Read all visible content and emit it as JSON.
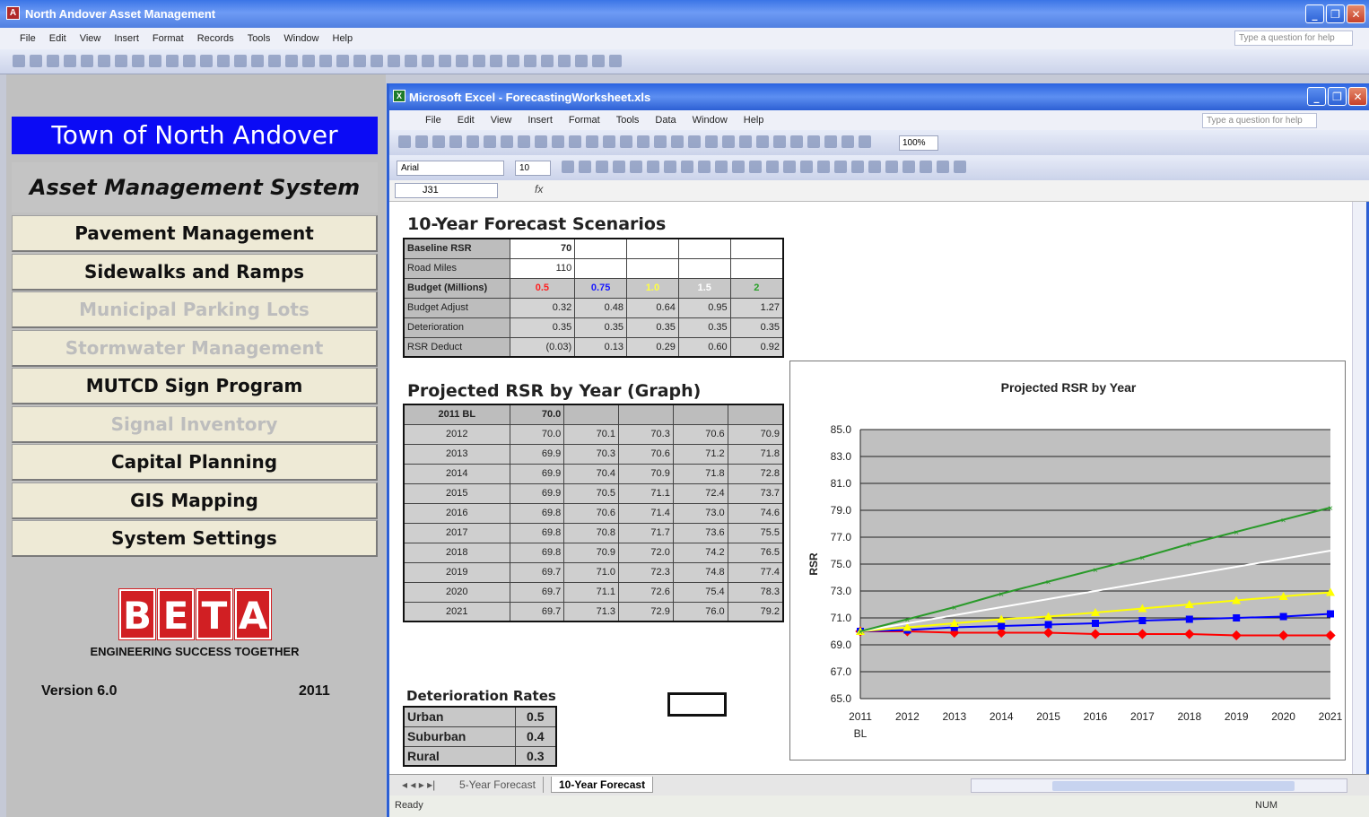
{
  "access_window": {
    "title": "North Andover Asset Management",
    "menu": [
      "File",
      "Edit",
      "View",
      "Insert",
      "Format",
      "Records",
      "Tools",
      "Window",
      "Help"
    ],
    "help_placeholder": "Type a question for help"
  },
  "switchboard": {
    "town": "Town of North Andover",
    "system": "Asset Management System",
    "buttons": [
      {
        "label": "Pavement Management",
        "enabled": true
      },
      {
        "label": "Sidewalks and  Ramps",
        "enabled": true
      },
      {
        "label": "Municipal Parking Lots",
        "enabled": false
      },
      {
        "label": "Stormwater Management",
        "enabled": false
      },
      {
        "label": "MUTCD Sign Program",
        "enabled": true
      },
      {
        "label": "Signal Inventory",
        "enabled": false
      },
      {
        "label": "Capital Planning",
        "enabled": true
      },
      {
        "label": "GIS Mapping",
        "enabled": true
      },
      {
        "label": "System Settings",
        "enabled": true
      }
    ],
    "logo_letters": [
      "B",
      "E",
      "T",
      "A"
    ],
    "tagline": "ENGINEERING  SUCCESS TOGETHER",
    "version": "Version 6.0",
    "year": "2011"
  },
  "excel_window": {
    "title": "Microsoft Excel - ForecastingWorksheet.xls",
    "menu": [
      "File",
      "Edit",
      "View",
      "Insert",
      "Format",
      "Tools",
      "Data",
      "Window",
      "Help"
    ],
    "help_placeholder": "Type a question for help",
    "font": "Arial",
    "font_size": "10",
    "zoom": "100%",
    "name_box": "J31",
    "fx": "fx",
    "status": "Ready",
    "num": "NUM",
    "tabs": [
      "5-Year Forecast",
      "10-Year Forecast"
    ],
    "active_tab": "10-Year Forecast"
  },
  "forecast": {
    "title": "10-Year Forecast Scenarios",
    "rows": [
      {
        "label": "Baseline RSR",
        "cells": [
          "70",
          "",
          "",
          "",
          ""
        ]
      },
      {
        "label": "Road Miles",
        "cells": [
          "110",
          "",
          "",
          "",
          ""
        ]
      },
      {
        "label": "Budget (Millions)",
        "cells": [
          "0.5",
          "0.75",
          "1.0",
          "1.5",
          "2"
        ]
      },
      {
        "label": "Budget Adjust",
        "cells": [
          "0.32",
          "0.48",
          "0.64",
          "0.95",
          "1.27"
        ]
      },
      {
        "label": "Deterioration",
        "cells": [
          "0.35",
          "0.35",
          "0.35",
          "0.35",
          "0.35"
        ]
      },
      {
        "label": "RSR Deduct",
        "cells": [
          "(0.03)",
          "0.13",
          "0.29",
          "0.60",
          "0.92"
        ]
      }
    ],
    "budget_colors": [
      "#ff2020",
      "#1a1aff",
      "#ffff40",
      "#ffffff",
      "#28a028"
    ]
  },
  "projected": {
    "title": "Projected RSR by Year (Graph)",
    "header": [
      "2011 BL",
      "70.0"
    ],
    "rows": [
      [
        "2012",
        "70.0",
        "70.1",
        "70.3",
        "70.6",
        "70.9"
      ],
      [
        "2013",
        "69.9",
        "70.3",
        "70.6",
        "71.2",
        "71.8"
      ],
      [
        "2014",
        "69.9",
        "70.4",
        "70.9",
        "71.8",
        "72.8"
      ],
      [
        "2015",
        "69.9",
        "70.5",
        "71.1",
        "72.4",
        "73.7"
      ],
      [
        "2016",
        "69.8",
        "70.6",
        "71.4",
        "73.0",
        "74.6"
      ],
      [
        "2017",
        "69.8",
        "70.8",
        "71.7",
        "73.6",
        "75.5"
      ],
      [
        "2018",
        "69.8",
        "70.9",
        "72.0",
        "74.2",
        "76.5"
      ],
      [
        "2019",
        "69.7",
        "71.0",
        "72.3",
        "74.8",
        "77.4"
      ],
      [
        "2020",
        "69.7",
        "71.1",
        "72.6",
        "75.4",
        "78.3"
      ],
      [
        "2021",
        "69.7",
        "71.3",
        "72.9",
        "76.0",
        "79.2"
      ]
    ]
  },
  "deterioration": {
    "title": "Deterioration Rates",
    "rows": [
      [
        "Urban",
        "0.5"
      ],
      [
        "Suburban",
        "0.4"
      ],
      [
        "Rural",
        "0.3"
      ]
    ]
  },
  "chart_data": {
    "type": "line",
    "title": "Projected RSR by Year",
    "xlabel": "",
    "ylabel": "RSR",
    "categories": [
      "2011 BL",
      "2012",
      "2013",
      "2014",
      "2015",
      "2016",
      "2017",
      "2018",
      "2019",
      "2020",
      "2021"
    ],
    "ylim": [
      65,
      85
    ],
    "yticks": [
      "85.0",
      "83.0",
      "81.0",
      "79.0",
      "77.0",
      "75.0",
      "73.0",
      "71.0",
      "69.0",
      "67.0",
      "65.0"
    ],
    "grid": true,
    "series": [
      {
        "color": "#ff0000",
        "values": [
          70.0,
          70.0,
          69.9,
          69.9,
          69.9,
          69.8,
          69.8,
          69.8,
          69.7,
          69.7,
          69.7
        ]
      },
      {
        "color": "#0000ff",
        "values": [
          70.0,
          70.1,
          70.3,
          70.4,
          70.5,
          70.6,
          70.8,
          70.9,
          71.0,
          71.1,
          71.3
        ]
      },
      {
        "color": "#ffff00",
        "values": [
          70.0,
          70.3,
          70.6,
          70.9,
          71.1,
          71.4,
          71.7,
          72.0,
          72.3,
          72.6,
          72.9
        ]
      },
      {
        "color": "#ffffff",
        "values": [
          70.0,
          70.6,
          71.2,
          71.8,
          72.4,
          73.0,
          73.6,
          74.2,
          74.8,
          75.4,
          76.0
        ]
      },
      {
        "color": "#2a9a2a",
        "values": [
          70.0,
          70.9,
          71.8,
          72.8,
          73.7,
          74.6,
          75.5,
          76.5,
          77.4,
          78.3,
          79.2
        ]
      }
    ]
  }
}
